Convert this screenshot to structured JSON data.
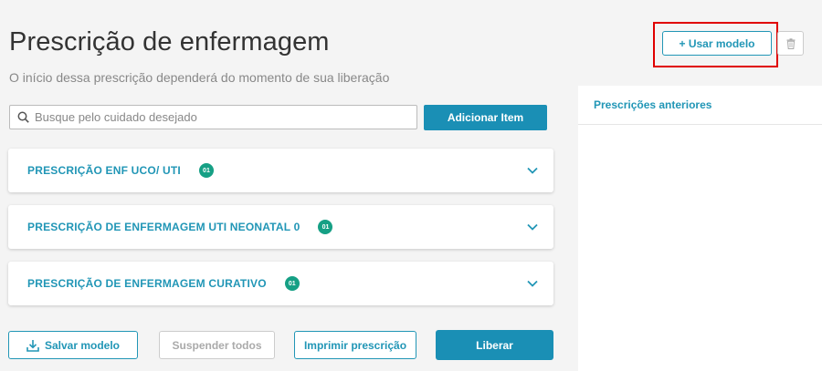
{
  "header": {
    "title": "Prescrição de enfermagem",
    "subtitle": "O início dessa prescrição dependerá do momento de sua liberação"
  },
  "top_actions": {
    "use_model_label": "+ Usar modelo"
  },
  "search": {
    "placeholder": "Busque pelo cuidado desejado",
    "value": ""
  },
  "add_item_label": "Adicionar Item",
  "prescriptions": [
    {
      "title": "PRESCRIÇÃO ENF UCO/ UTI",
      "count": "01"
    },
    {
      "title": "PRESCRIÇÃO DE ENFERMAGEM UTI NEONATAL 0",
      "count": "01"
    },
    {
      "title": "PRESCRIÇÃO DE ENFERMAGEM CURATIVO",
      "count": "01"
    }
  ],
  "side_panel": {
    "title": "Prescrições anteriores"
  },
  "footer": {
    "save_model_label": "Salvar modelo",
    "suspend_all_label": "Suspender todos",
    "print_label": "Imprimir prescrição",
    "release_label": "Liberar"
  },
  "colors": {
    "accent": "#2196b6",
    "primary_button": "#1a8fb5",
    "badge": "#16a085",
    "highlight": "#e00000"
  }
}
